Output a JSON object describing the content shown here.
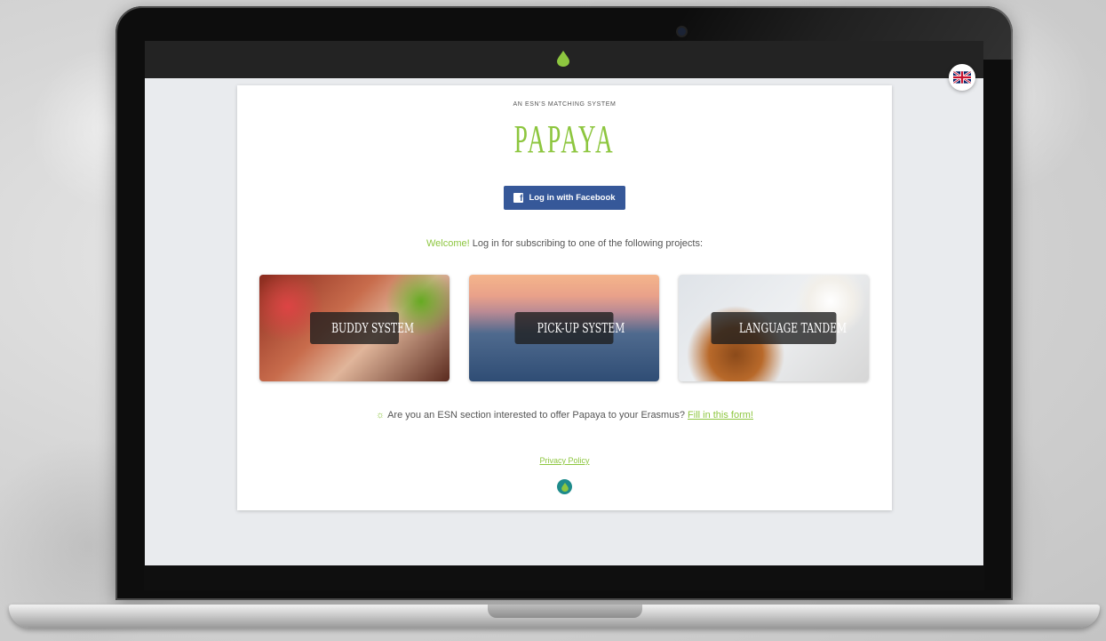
{
  "header": {
    "logo_icon": "papaya-leaf-icon",
    "language_icon": "uk-flag-icon"
  },
  "hero": {
    "subtitle": "AN ESN'S MATCHING SYSTEM",
    "brand": "PAPAYA"
  },
  "login": {
    "facebook_label": "Log in with Facebook",
    "icon": "facebook-icon"
  },
  "welcome": {
    "highlight": "Welcome!",
    "text": " Log in for subscribing to one of the following projects:"
  },
  "projects": [
    {
      "label": "BUDDY SYSTEM"
    },
    {
      "label": "PICK-UP SYSTEM"
    },
    {
      "label": "LANGUAGE TANDEM"
    }
  ],
  "offer": {
    "icon": "lightbulb-icon",
    "text": "Are you an ESN section interested to offer Papaya to your Erasmus?",
    "link": "Fill in this form!"
  },
  "footer": {
    "privacy_link": "Privacy Policy",
    "logo_icon": "papaya-footer-icon"
  },
  "colors": {
    "brand_green": "#8dc63f",
    "facebook_blue": "#365899",
    "topbar": "#232323",
    "teal": "#1e8b8b"
  }
}
